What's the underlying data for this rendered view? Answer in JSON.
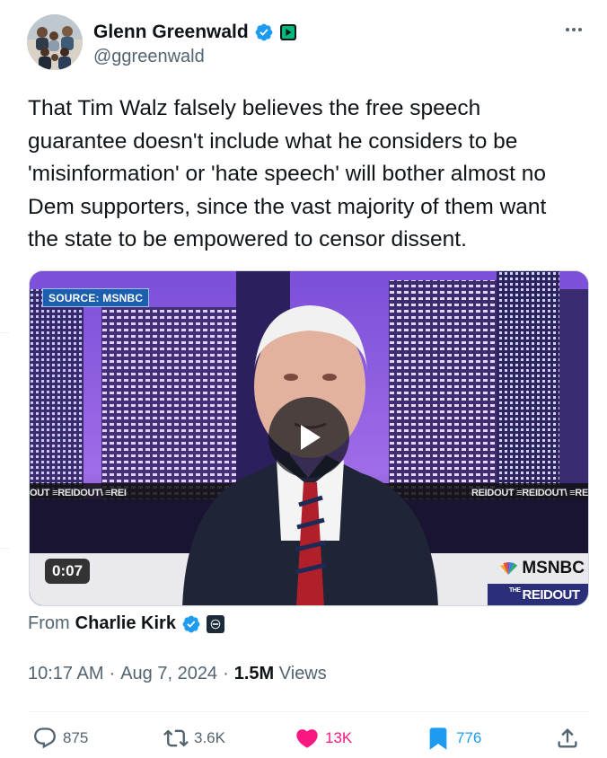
{
  "author": {
    "display_name": "Glenn Greenwald",
    "handle": "@ggreenwald",
    "verified": true
  },
  "tweet": {
    "text": "That Tim Walz falsely believes the free speech guarantee doesn't include what he considers to be 'misinformation' or 'hate speech' will bother almost no Dem supporters, since the vast majority of them want the state to be empowered to censor dissent."
  },
  "media": {
    "source_label": "SOURCE: MSNBC",
    "duration": "0:07",
    "network": "MSNBC",
    "show": "REIDOUT",
    "show_prefix": "THE",
    "ticker_left": "OUT   ≡REIDOUT\\   ≡REI",
    "ticker_right": "REIDOUT   ≡REIDOUT\\   ≡RE"
  },
  "attribution": {
    "prefix": "From",
    "name": "Charlie Kirk"
  },
  "meta": {
    "time": "10:17 AM",
    "separator": "·",
    "date": "Aug 7, 2024",
    "views_count": "1.5M",
    "views_label": "Views"
  },
  "actions": {
    "replies": "875",
    "reposts": "3.6K",
    "likes": "13K",
    "bookmarks": "776"
  },
  "colors": {
    "brand_blue": "#1d9bf0",
    "like_pink": "#f91880",
    "secondary_text": "#536471",
    "affiliate_green": "#00ba7c"
  },
  "icons": {
    "verified": "verified-badge-icon",
    "affiliate": "rumble-affiliate-icon",
    "more": "more-dots-icon",
    "reply": "reply-icon",
    "repost": "repost-icon",
    "like": "heart-icon",
    "bookmark": "bookmark-icon",
    "share": "share-icon",
    "play": "play-icon"
  }
}
